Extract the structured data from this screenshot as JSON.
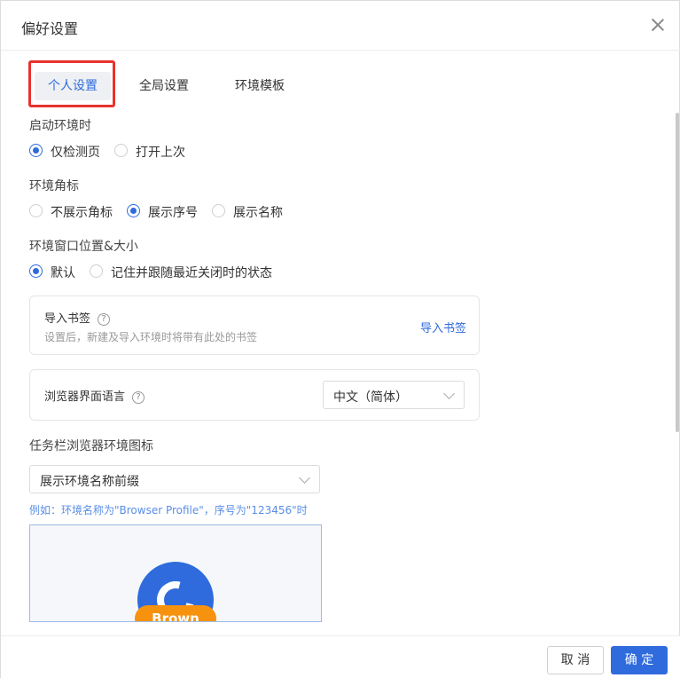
{
  "dialog": {
    "title": "偏好设置"
  },
  "tabs": [
    {
      "label": "个人设置",
      "active": true
    },
    {
      "label": "全局设置",
      "active": false
    },
    {
      "label": "环境模板",
      "active": false
    }
  ],
  "startup": {
    "label": "启动环境时",
    "options": [
      {
        "label": "仅检测页",
        "selected": true
      },
      {
        "label": "打开上次",
        "selected": false
      }
    ]
  },
  "corner_mark": {
    "label": "环境角标",
    "options": [
      {
        "label": "不展示角标",
        "selected": false
      },
      {
        "label": "展示序号",
        "selected": true
      },
      {
        "label": "展示名称",
        "selected": false
      }
    ]
  },
  "window": {
    "label": "环境窗口位置&大小",
    "options": [
      {
        "label": "默认",
        "selected": true
      },
      {
        "label": "记住并跟随最近关闭时的状态",
        "selected": false
      }
    ]
  },
  "bookmarks": {
    "title": "导入书签",
    "help_icon": "question-circle-icon",
    "desc": "设置后，新建及导入环境时将带有此处的书签",
    "action": "导入书签"
  },
  "language": {
    "label": "浏览器界面语言",
    "help_icon": "question-circle-icon",
    "selected": "中文（简体）"
  },
  "taskbar": {
    "label": "任务栏浏览器环境图标",
    "selected": "展示环境名称前缀",
    "hint": "例如：环境名称为\"Browser Profile\"，序号为\"123456\"时",
    "preview_badge": "Brown"
  },
  "footer": {
    "cancel": "取 消",
    "confirm": "确 定"
  },
  "colors": {
    "accent": "#2f6bdc",
    "highlight": "#e8332c",
    "badge": "#f7920f"
  }
}
